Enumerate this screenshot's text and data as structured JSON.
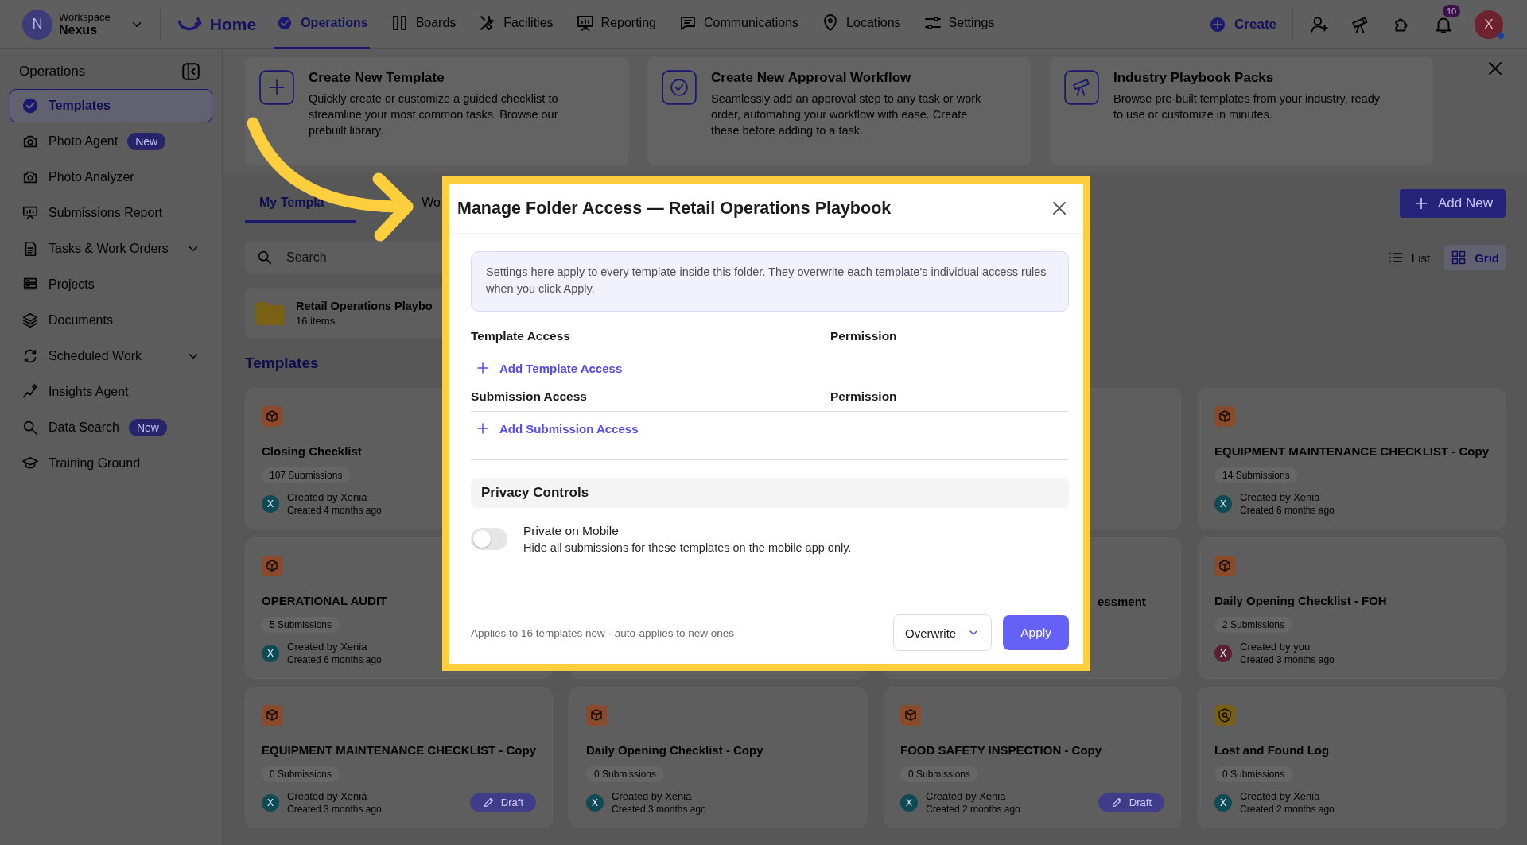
{
  "workspace": {
    "avatar": "N",
    "label": "Workspace",
    "name": "Nexus"
  },
  "nav": {
    "home": "Home",
    "items": [
      {
        "label": "Operations",
        "selected": true
      },
      {
        "label": "Boards",
        "selected": false
      },
      {
        "label": "Facilities",
        "selected": false
      },
      {
        "label": "Reporting",
        "selected": false
      },
      {
        "label": "Communications",
        "selected": false
      },
      {
        "label": "Locations",
        "selected": false
      },
      {
        "label": "Settings",
        "selected": false
      }
    ],
    "create": "Create",
    "notification_count": "10",
    "avatar": "X"
  },
  "sidebar": {
    "title": "Operations",
    "items": [
      {
        "label": "Templates",
        "kind": "link",
        "selected": true
      },
      {
        "label": "Photo Agent",
        "kind": "link",
        "selected": false,
        "badge": "New"
      },
      {
        "label": "Photo Analyzer",
        "kind": "link",
        "selected": false
      },
      {
        "label": "Submissions Report",
        "kind": "link",
        "selected": false
      },
      {
        "label": "Tasks & Work Orders",
        "kind": "group",
        "selected": false
      },
      {
        "label": "Projects",
        "kind": "link",
        "selected": false
      },
      {
        "label": "Documents",
        "kind": "link",
        "selected": false
      },
      {
        "label": "Scheduled Work",
        "kind": "group",
        "selected": false
      },
      {
        "label": "Insights Agent",
        "kind": "link",
        "selected": false
      },
      {
        "label": "Data Search",
        "kind": "link",
        "selected": false,
        "badge": "New"
      },
      {
        "label": "Training Ground",
        "kind": "link",
        "selected": false
      }
    ]
  },
  "quick_actions": [
    {
      "title": "Create New Template",
      "description": "Quickly create or customize a guided checklist to streamline your most common tasks. Browse our prebuilt library."
    },
    {
      "title": "Create New Approval Workflow",
      "description": "Seamlessly add an approval step to any task or work order, automating your workflow with ease. Create these before adding to a task."
    },
    {
      "title": "Industry Playbook Packs",
      "description": "Browse pre-built templates from your industry, ready to use or customize in minutes."
    }
  ],
  "tabs": [
    {
      "label": "My Templa",
      "selected": true
    },
    {
      "label": "Wo",
      "selected": false
    }
  ],
  "add_new": "Add New",
  "search": {
    "placeholder": "Search"
  },
  "views": [
    {
      "label": "List",
      "selected": false
    },
    {
      "label": "Grid",
      "selected": true
    }
  ],
  "folder": {
    "name": "Retail Operations Playbo",
    "count": "16 items"
  },
  "section_title": "Templates",
  "cards": [
    {
      "kind": "checklist",
      "title": "Closing Checklist",
      "submissions": "107 Submissions",
      "author": "Created by Xenia",
      "created": "Created 4 months ago",
      "draft": false,
      "avatar": "X",
      "color": "#0f4a55"
    },
    {
      "kind": "covered"
    },
    {
      "kind": "checklist",
      "title": "EQUIPMENT MAINTENANCE CHECKLIST - Copy",
      "submissions": "14 Submissions",
      "author": "Created by Xenia",
      "created": "Created 6 months ago",
      "draft": false,
      "avatar": "X",
      "color": "#0f4a55"
    },
    {
      "kind": "checklist",
      "title": "OPERATIONAL AUDIT",
      "submissions": "5 Submissions",
      "author": "Created by Xenia",
      "created": "Created 6 months ago",
      "draft": false,
      "avatar": "X",
      "color": "#0f4a55"
    },
    {
      "kind": "covered"
    },
    {
      "kind": "partial",
      "title": "essment"
    },
    {
      "kind": "checklist",
      "title": "Daily Opening Checklist - FOH",
      "submissions": "2 Submissions",
      "author": "Created by you",
      "created": "Created 3 months ago",
      "draft": false,
      "avatar": "X",
      "color": "#5a2030"
    },
    {
      "kind": "checklist",
      "title": "EQUIPMENT MAINTENANCE CHECKLIST - Copy",
      "submissions": "0 Submissions",
      "author": "Created by Xenia",
      "created": "Created 3 months ago",
      "draft": true,
      "draft_label": "Draft",
      "avatar": "X",
      "color": "#0f4a55"
    },
    {
      "kind": "checklist",
      "title": "Daily Opening Checklist - Copy",
      "submissions": "0 Submissions",
      "author": "Created by Xenia",
      "created": "Created 3 months ago",
      "draft": false,
      "avatar": "X",
      "color": "#0f4a55"
    },
    {
      "kind": "checklist",
      "title": "FOOD SAFETY INSPECTION - Copy",
      "submissions": "0 Submissions",
      "author": "Created by Xenia",
      "created": "Created 2 months ago",
      "draft": true,
      "draft_label": "Draft",
      "avatar": "X",
      "color": "#0f4a55"
    },
    {
      "kind": "log",
      "title": "Lost and Found Log",
      "submissions": "0 Submissions",
      "author": "Created by Xenia",
      "created": "Created 2 months ago",
      "draft": false,
      "avatar": "X",
      "color": "#0f4a55"
    }
  ],
  "modal": {
    "title": "Manage Folder Access — Retail Operations Playbook",
    "info": "Settings here apply to every template inside this folder. They overwrite each template's individual access rules when you click Apply.",
    "sections": [
      {
        "heading": "Template Access",
        "permission": "Permission",
        "add": "Add Template Access"
      },
      {
        "heading": "Submission Access",
        "permission": "Permission",
        "add": "Add Submission Access"
      }
    ],
    "privacy": {
      "title": "Privacy Controls",
      "toggles": [
        {
          "label": "Private on Mobile",
          "description": "Hide all submissions for these templates on the mobile app only.",
          "on": false
        }
      ]
    },
    "footer_note": "Applies to 16 templates now · auto-applies to new ones",
    "mode": "Overwrite",
    "apply": "Apply"
  }
}
